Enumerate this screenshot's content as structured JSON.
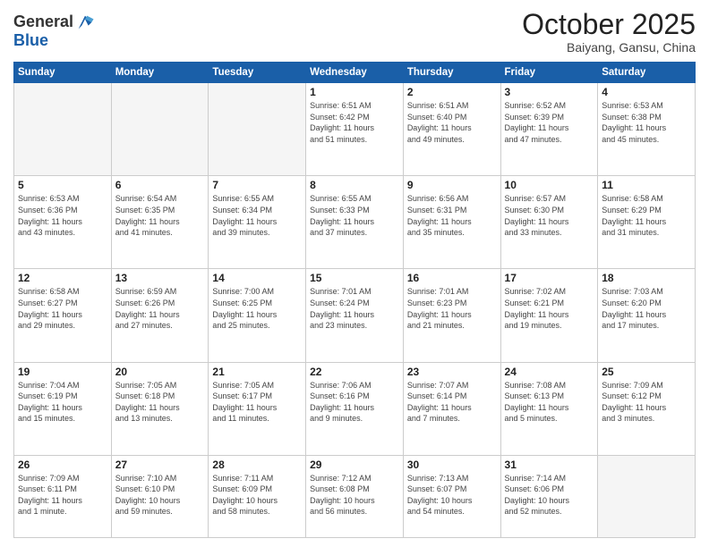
{
  "header": {
    "logo_line1": "General",
    "logo_line2": "Blue",
    "month": "October 2025",
    "location": "Baiyang, Gansu, China"
  },
  "weekdays": [
    "Sunday",
    "Monday",
    "Tuesday",
    "Wednesday",
    "Thursday",
    "Friday",
    "Saturday"
  ],
  "weeks": [
    [
      {
        "day": "",
        "info": ""
      },
      {
        "day": "",
        "info": ""
      },
      {
        "day": "",
        "info": ""
      },
      {
        "day": "1",
        "info": "Sunrise: 6:51 AM\nSunset: 6:42 PM\nDaylight: 11 hours\nand 51 minutes."
      },
      {
        "day": "2",
        "info": "Sunrise: 6:51 AM\nSunset: 6:40 PM\nDaylight: 11 hours\nand 49 minutes."
      },
      {
        "day": "3",
        "info": "Sunrise: 6:52 AM\nSunset: 6:39 PM\nDaylight: 11 hours\nand 47 minutes."
      },
      {
        "day": "4",
        "info": "Sunrise: 6:53 AM\nSunset: 6:38 PM\nDaylight: 11 hours\nand 45 minutes."
      }
    ],
    [
      {
        "day": "5",
        "info": "Sunrise: 6:53 AM\nSunset: 6:36 PM\nDaylight: 11 hours\nand 43 minutes."
      },
      {
        "day": "6",
        "info": "Sunrise: 6:54 AM\nSunset: 6:35 PM\nDaylight: 11 hours\nand 41 minutes."
      },
      {
        "day": "7",
        "info": "Sunrise: 6:55 AM\nSunset: 6:34 PM\nDaylight: 11 hours\nand 39 minutes."
      },
      {
        "day": "8",
        "info": "Sunrise: 6:55 AM\nSunset: 6:33 PM\nDaylight: 11 hours\nand 37 minutes."
      },
      {
        "day": "9",
        "info": "Sunrise: 6:56 AM\nSunset: 6:31 PM\nDaylight: 11 hours\nand 35 minutes."
      },
      {
        "day": "10",
        "info": "Sunrise: 6:57 AM\nSunset: 6:30 PM\nDaylight: 11 hours\nand 33 minutes."
      },
      {
        "day": "11",
        "info": "Sunrise: 6:58 AM\nSunset: 6:29 PM\nDaylight: 11 hours\nand 31 minutes."
      }
    ],
    [
      {
        "day": "12",
        "info": "Sunrise: 6:58 AM\nSunset: 6:27 PM\nDaylight: 11 hours\nand 29 minutes."
      },
      {
        "day": "13",
        "info": "Sunrise: 6:59 AM\nSunset: 6:26 PM\nDaylight: 11 hours\nand 27 minutes."
      },
      {
        "day": "14",
        "info": "Sunrise: 7:00 AM\nSunset: 6:25 PM\nDaylight: 11 hours\nand 25 minutes."
      },
      {
        "day": "15",
        "info": "Sunrise: 7:01 AM\nSunset: 6:24 PM\nDaylight: 11 hours\nand 23 minutes."
      },
      {
        "day": "16",
        "info": "Sunrise: 7:01 AM\nSunset: 6:23 PM\nDaylight: 11 hours\nand 21 minutes."
      },
      {
        "day": "17",
        "info": "Sunrise: 7:02 AM\nSunset: 6:21 PM\nDaylight: 11 hours\nand 19 minutes."
      },
      {
        "day": "18",
        "info": "Sunrise: 7:03 AM\nSunset: 6:20 PM\nDaylight: 11 hours\nand 17 minutes."
      }
    ],
    [
      {
        "day": "19",
        "info": "Sunrise: 7:04 AM\nSunset: 6:19 PM\nDaylight: 11 hours\nand 15 minutes."
      },
      {
        "day": "20",
        "info": "Sunrise: 7:05 AM\nSunset: 6:18 PM\nDaylight: 11 hours\nand 13 minutes."
      },
      {
        "day": "21",
        "info": "Sunrise: 7:05 AM\nSunset: 6:17 PM\nDaylight: 11 hours\nand 11 minutes."
      },
      {
        "day": "22",
        "info": "Sunrise: 7:06 AM\nSunset: 6:16 PM\nDaylight: 11 hours\nand 9 minutes."
      },
      {
        "day": "23",
        "info": "Sunrise: 7:07 AM\nSunset: 6:14 PM\nDaylight: 11 hours\nand 7 minutes."
      },
      {
        "day": "24",
        "info": "Sunrise: 7:08 AM\nSunset: 6:13 PM\nDaylight: 11 hours\nand 5 minutes."
      },
      {
        "day": "25",
        "info": "Sunrise: 7:09 AM\nSunset: 6:12 PM\nDaylight: 11 hours\nand 3 minutes."
      }
    ],
    [
      {
        "day": "26",
        "info": "Sunrise: 7:09 AM\nSunset: 6:11 PM\nDaylight: 11 hours\nand 1 minute."
      },
      {
        "day": "27",
        "info": "Sunrise: 7:10 AM\nSunset: 6:10 PM\nDaylight: 10 hours\nand 59 minutes."
      },
      {
        "day": "28",
        "info": "Sunrise: 7:11 AM\nSunset: 6:09 PM\nDaylight: 10 hours\nand 58 minutes."
      },
      {
        "day": "29",
        "info": "Sunrise: 7:12 AM\nSunset: 6:08 PM\nDaylight: 10 hours\nand 56 minutes."
      },
      {
        "day": "30",
        "info": "Sunrise: 7:13 AM\nSunset: 6:07 PM\nDaylight: 10 hours\nand 54 minutes."
      },
      {
        "day": "31",
        "info": "Sunrise: 7:14 AM\nSunset: 6:06 PM\nDaylight: 10 hours\nand 52 minutes."
      },
      {
        "day": "",
        "info": ""
      }
    ]
  ]
}
